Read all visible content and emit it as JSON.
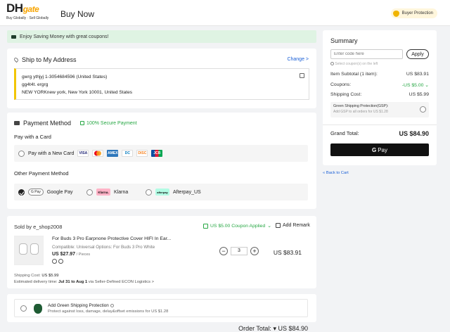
{
  "header": {
    "logo_main": "DH",
    "logo_accent": "gate",
    "logo_tagline": "Buy Globally · Sell Globally",
    "page_title": "Buy Now",
    "buyer_protection": "Buyer Protection"
  },
  "banner": {
    "text": "Enjoy Saving Money with great coupons!"
  },
  "address": {
    "title": "Ship to My Address",
    "change_label": "Change >",
    "name_line": "gwrg ythjyj   1-3054684596 (United States)",
    "line1": "gg4t4t. ergrg",
    "line2": "NEW YORKnew york, New York 10001, United States"
  },
  "payment": {
    "title": "Payment Method",
    "secure": "100% Secure Payment",
    "pay_with_card": "Pay with a Card",
    "new_card": "Pay with a New Card",
    "card_brands": [
      "VISA",
      "MC",
      "AMEX",
      "DC",
      "DISC",
      "JCB"
    ],
    "other_title": "Other Payment Method",
    "google_pill": "G Pay",
    "google_label": "Google Pay",
    "klarna_logo": "Klarna.",
    "klarna_label": "Klarna",
    "afterpay_logo": "afterpay",
    "afterpay_label": "Afterpay_US"
  },
  "order": {
    "seller_prefix": "Sold by ",
    "seller": "e_shop2008",
    "coupon_applied": "US $5.00 Coupon Applied",
    "add_remark": "Add Remark",
    "product_title": "For Buds 3 Pro Earpnone Protective Cover HIFI In Ear...",
    "options": "Compatible: Universal   Options: For Buds 3 Pro White",
    "price": "US $27.97",
    "price_unit": " / Pieces",
    "quantity": "3",
    "line_total": "US $83.91",
    "shipping_cost_label": "Shipping Cost:  ",
    "shipping_cost": "US $5.99",
    "delivery_prefix": "Estimated delivery time: ",
    "delivery_dates": "Jul 31 to Aug 1",
    "delivery_suffix": " via Seller-Defined ECON Logistics  >",
    "order_total_label": "Order Total:  ",
    "order_total": "US $84.90"
  },
  "gsp": {
    "title": "Add Green Shipping Protection",
    "desc": "Protect against loss, damage, delay&offset emissions for US $1.28"
  },
  "summary": {
    "title": "Summary",
    "code_placeholder": "Enter code here",
    "apply": "Apply",
    "hint": "Select coupon(s) on the left",
    "item_subtotal_label": "Item Subtotal (1 item):",
    "item_subtotal": "US $83.91",
    "coupons_label": "Coupons:",
    "coupons": "-US $5.00",
    "shipping_label": "Shipping Cost:",
    "shipping": "US $5.99",
    "gsp_title": "Green Shipping Protection(GSP):",
    "gsp_desc": "Add GSP to all orders for US $1.28",
    "grand_label": "Grand Total:",
    "grand_total": "US $84.90",
    "gpay": "Pay",
    "back": "« Back to Cart"
  }
}
